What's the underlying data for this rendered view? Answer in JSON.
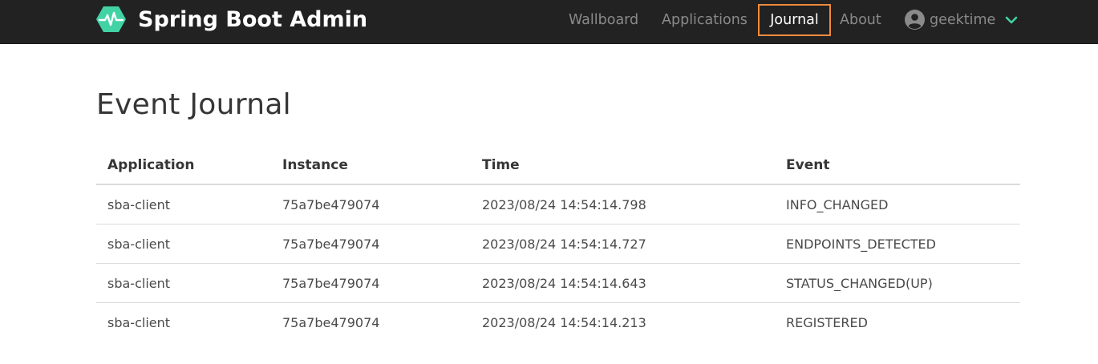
{
  "navbar": {
    "brand_title": "Spring Boot Admin",
    "logo_icon": "heartbeat-hexagon-icon",
    "accent_color": "#42d3a5",
    "active_border_color": "#ee8a3c",
    "items": [
      {
        "label": "Wallboard",
        "active": false
      },
      {
        "label": "Applications",
        "active": false
      },
      {
        "label": "Journal",
        "active": true
      },
      {
        "label": "About",
        "active": false
      }
    ],
    "user": {
      "name": "geektime",
      "icon": "user-circle-icon",
      "dropdown_icon": "chevron-down-icon"
    }
  },
  "page": {
    "title": "Event Journal"
  },
  "table": {
    "columns": [
      "Application",
      "Instance",
      "Time",
      "Event"
    ],
    "rows": [
      {
        "application": "sba-client",
        "instance": "75a7be479074",
        "time": "2023/08/24 14:54:14.798",
        "event": "INFO_CHANGED"
      },
      {
        "application": "sba-client",
        "instance": "75a7be479074",
        "time": "2023/08/24 14:54:14.727",
        "event": "ENDPOINTS_DETECTED"
      },
      {
        "application": "sba-client",
        "instance": "75a7be479074",
        "time": "2023/08/24 14:54:14.643",
        "event": "STATUS_CHANGED(UP)"
      },
      {
        "application": "sba-client",
        "instance": "75a7be479074",
        "time": "2023/08/24 14:54:14.213",
        "event": "REGISTERED"
      }
    ]
  }
}
